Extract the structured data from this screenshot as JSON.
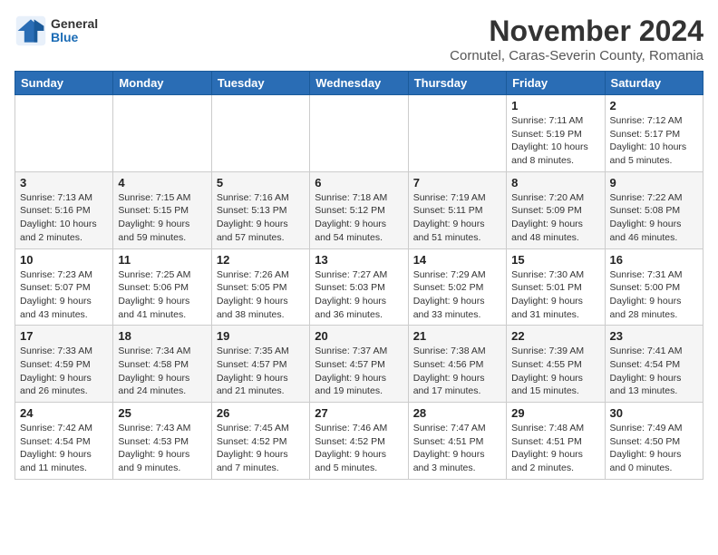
{
  "header": {
    "logo_general": "General",
    "logo_blue": "Blue",
    "month": "November 2024",
    "location": "Cornutel, Caras-Severin County, Romania"
  },
  "weekdays": [
    "Sunday",
    "Monday",
    "Tuesday",
    "Wednesday",
    "Thursday",
    "Friday",
    "Saturday"
  ],
  "weeks": [
    [
      {
        "day": "",
        "info": ""
      },
      {
        "day": "",
        "info": ""
      },
      {
        "day": "",
        "info": ""
      },
      {
        "day": "",
        "info": ""
      },
      {
        "day": "",
        "info": ""
      },
      {
        "day": "1",
        "info": "Sunrise: 7:11 AM\nSunset: 5:19 PM\nDaylight: 10 hours\nand 8 minutes."
      },
      {
        "day": "2",
        "info": "Sunrise: 7:12 AM\nSunset: 5:17 PM\nDaylight: 10 hours\nand 5 minutes."
      }
    ],
    [
      {
        "day": "3",
        "info": "Sunrise: 7:13 AM\nSunset: 5:16 PM\nDaylight: 10 hours\nand 2 minutes."
      },
      {
        "day": "4",
        "info": "Sunrise: 7:15 AM\nSunset: 5:15 PM\nDaylight: 9 hours\nand 59 minutes."
      },
      {
        "day": "5",
        "info": "Sunrise: 7:16 AM\nSunset: 5:13 PM\nDaylight: 9 hours\nand 57 minutes."
      },
      {
        "day": "6",
        "info": "Sunrise: 7:18 AM\nSunset: 5:12 PM\nDaylight: 9 hours\nand 54 minutes."
      },
      {
        "day": "7",
        "info": "Sunrise: 7:19 AM\nSunset: 5:11 PM\nDaylight: 9 hours\nand 51 minutes."
      },
      {
        "day": "8",
        "info": "Sunrise: 7:20 AM\nSunset: 5:09 PM\nDaylight: 9 hours\nand 48 minutes."
      },
      {
        "day": "9",
        "info": "Sunrise: 7:22 AM\nSunset: 5:08 PM\nDaylight: 9 hours\nand 46 minutes."
      }
    ],
    [
      {
        "day": "10",
        "info": "Sunrise: 7:23 AM\nSunset: 5:07 PM\nDaylight: 9 hours\nand 43 minutes."
      },
      {
        "day": "11",
        "info": "Sunrise: 7:25 AM\nSunset: 5:06 PM\nDaylight: 9 hours\nand 41 minutes."
      },
      {
        "day": "12",
        "info": "Sunrise: 7:26 AM\nSunset: 5:05 PM\nDaylight: 9 hours\nand 38 minutes."
      },
      {
        "day": "13",
        "info": "Sunrise: 7:27 AM\nSunset: 5:03 PM\nDaylight: 9 hours\nand 36 minutes."
      },
      {
        "day": "14",
        "info": "Sunrise: 7:29 AM\nSunset: 5:02 PM\nDaylight: 9 hours\nand 33 minutes."
      },
      {
        "day": "15",
        "info": "Sunrise: 7:30 AM\nSunset: 5:01 PM\nDaylight: 9 hours\nand 31 minutes."
      },
      {
        "day": "16",
        "info": "Sunrise: 7:31 AM\nSunset: 5:00 PM\nDaylight: 9 hours\nand 28 minutes."
      }
    ],
    [
      {
        "day": "17",
        "info": "Sunrise: 7:33 AM\nSunset: 4:59 PM\nDaylight: 9 hours\nand 26 minutes."
      },
      {
        "day": "18",
        "info": "Sunrise: 7:34 AM\nSunset: 4:58 PM\nDaylight: 9 hours\nand 24 minutes."
      },
      {
        "day": "19",
        "info": "Sunrise: 7:35 AM\nSunset: 4:57 PM\nDaylight: 9 hours\nand 21 minutes."
      },
      {
        "day": "20",
        "info": "Sunrise: 7:37 AM\nSunset: 4:57 PM\nDaylight: 9 hours\nand 19 minutes."
      },
      {
        "day": "21",
        "info": "Sunrise: 7:38 AM\nSunset: 4:56 PM\nDaylight: 9 hours\nand 17 minutes."
      },
      {
        "day": "22",
        "info": "Sunrise: 7:39 AM\nSunset: 4:55 PM\nDaylight: 9 hours\nand 15 minutes."
      },
      {
        "day": "23",
        "info": "Sunrise: 7:41 AM\nSunset: 4:54 PM\nDaylight: 9 hours\nand 13 minutes."
      }
    ],
    [
      {
        "day": "24",
        "info": "Sunrise: 7:42 AM\nSunset: 4:54 PM\nDaylight: 9 hours\nand 11 minutes."
      },
      {
        "day": "25",
        "info": "Sunrise: 7:43 AM\nSunset: 4:53 PM\nDaylight: 9 hours\nand 9 minutes."
      },
      {
        "day": "26",
        "info": "Sunrise: 7:45 AM\nSunset: 4:52 PM\nDaylight: 9 hours\nand 7 minutes."
      },
      {
        "day": "27",
        "info": "Sunrise: 7:46 AM\nSunset: 4:52 PM\nDaylight: 9 hours\nand 5 minutes."
      },
      {
        "day": "28",
        "info": "Sunrise: 7:47 AM\nSunset: 4:51 PM\nDaylight: 9 hours\nand 3 minutes."
      },
      {
        "day": "29",
        "info": "Sunrise: 7:48 AM\nSunset: 4:51 PM\nDaylight: 9 hours\nand 2 minutes."
      },
      {
        "day": "30",
        "info": "Sunrise: 7:49 AM\nSunset: 4:50 PM\nDaylight: 9 hours\nand 0 minutes."
      }
    ]
  ]
}
